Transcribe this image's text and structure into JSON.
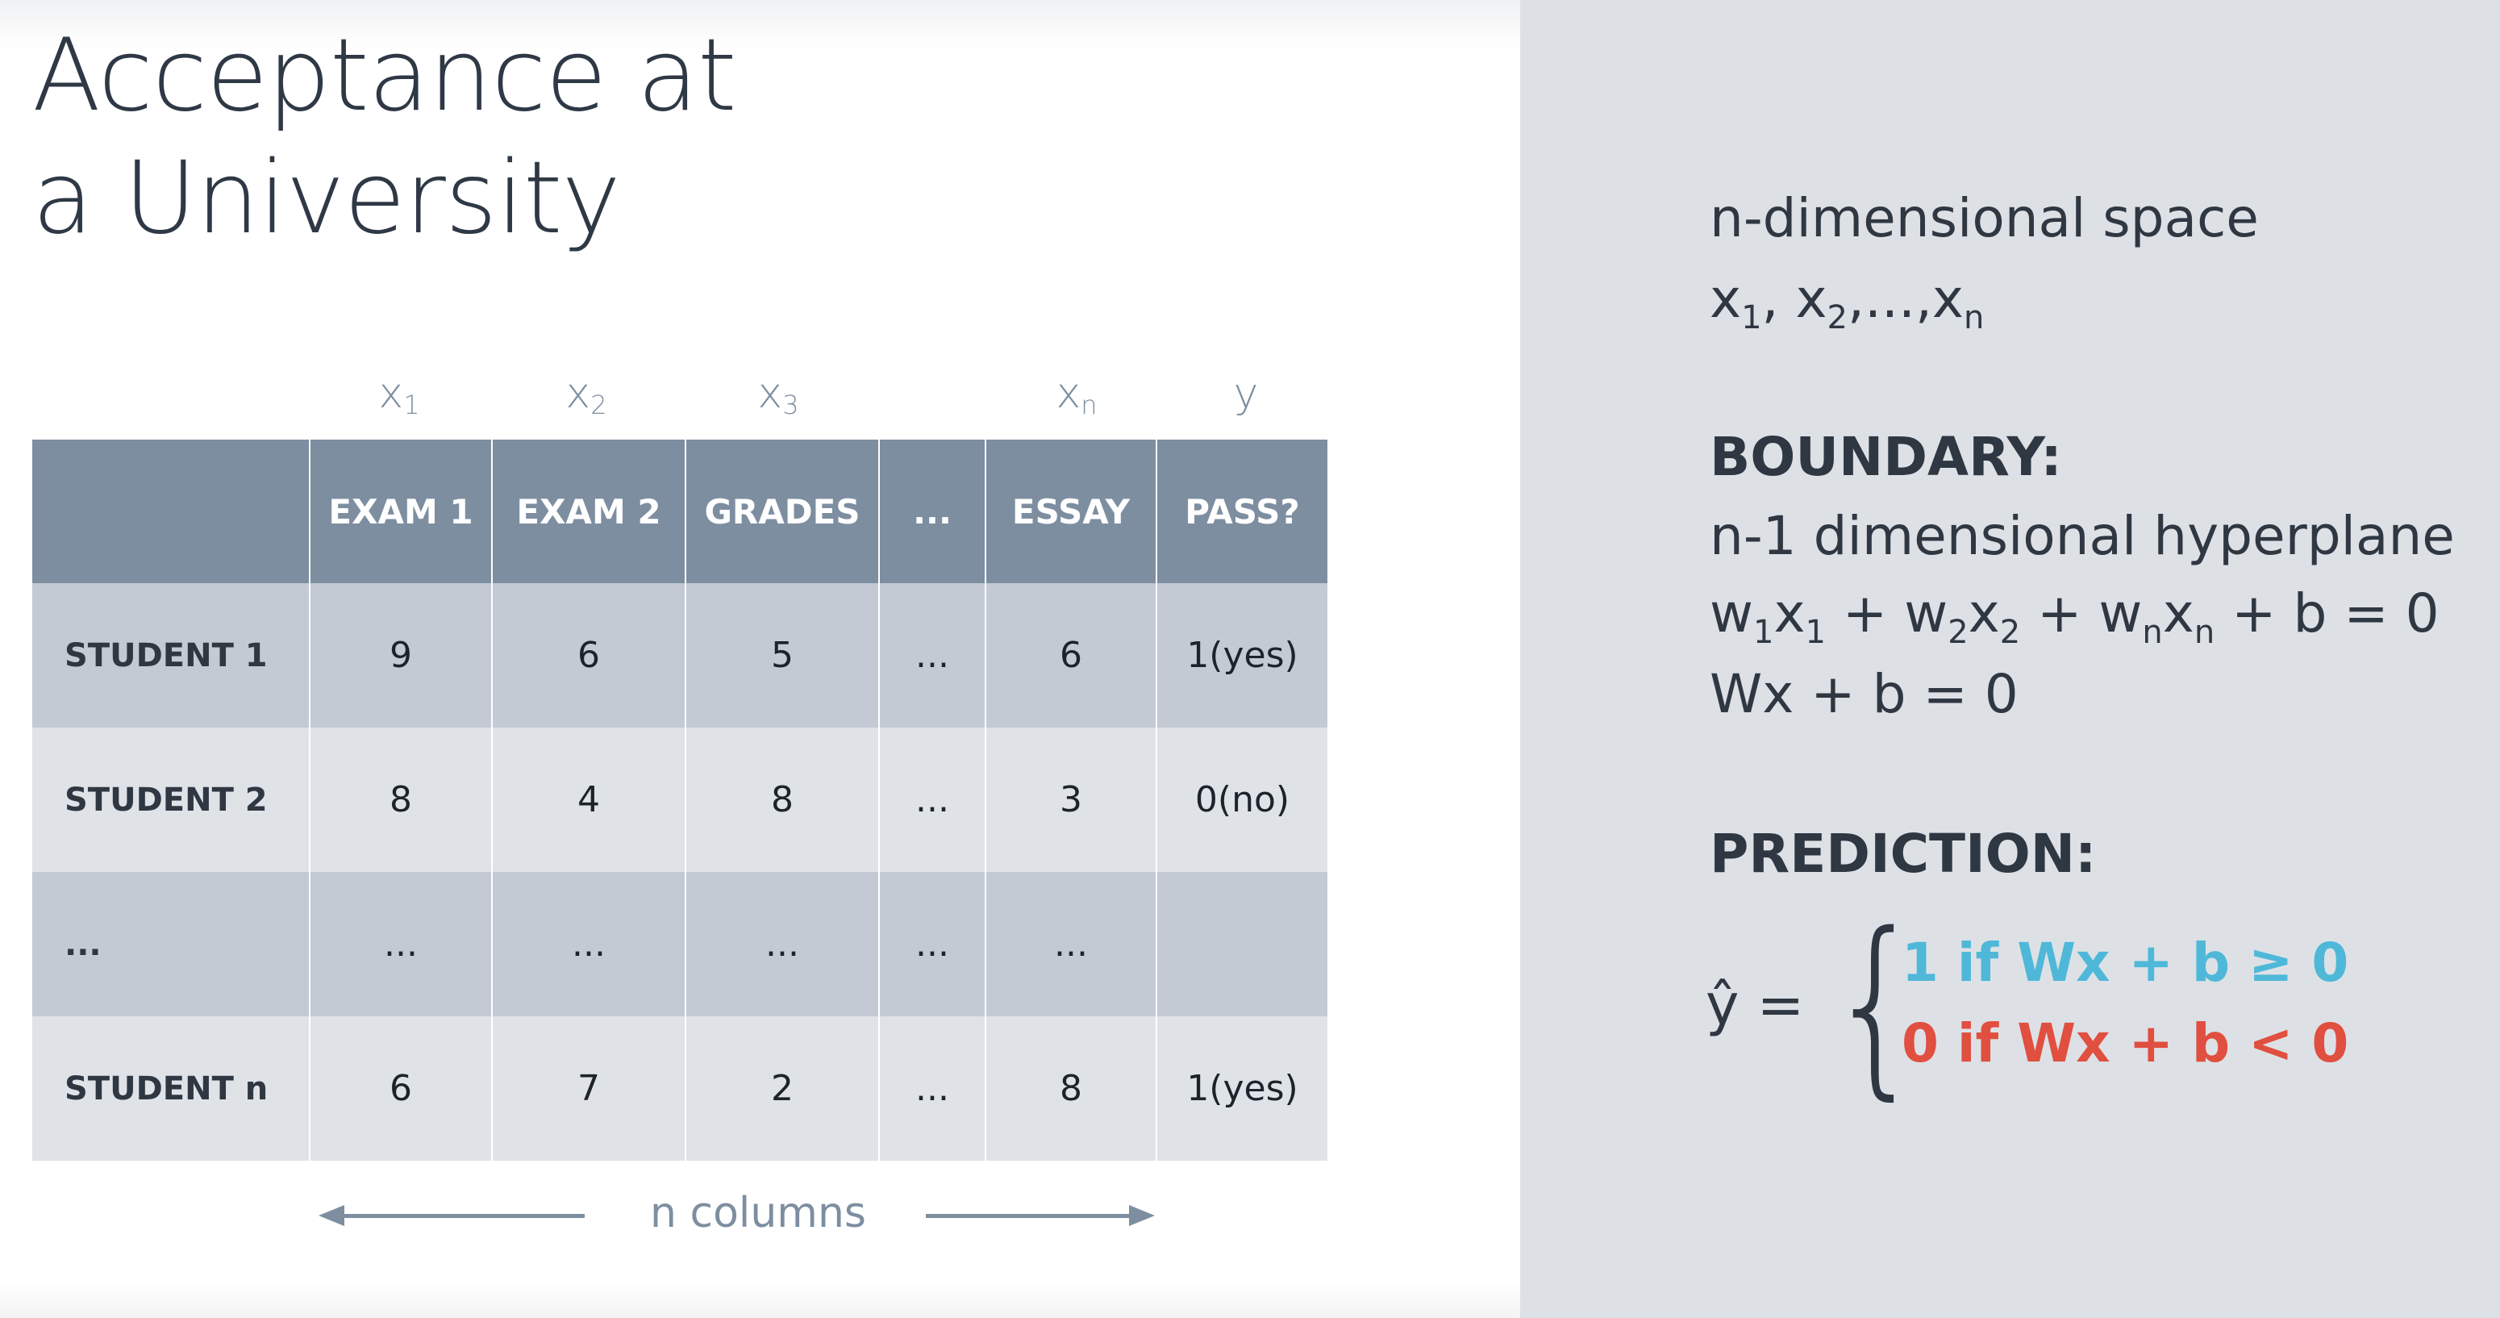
{
  "title": {
    "line1": "Acceptance at",
    "line2": "a University"
  },
  "variables": [
    {
      "base": "x",
      "sub": "1"
    },
    {
      "base": "x",
      "sub": "2"
    },
    {
      "base": "x",
      "sub": "3"
    },
    {
      "base": "x",
      "sub": "n"
    },
    {
      "base": "y",
      "sub": ""
    }
  ],
  "table": {
    "headers": [
      "",
      "EXAM 1",
      "EXAM 2",
      "GRADES",
      "...",
      "ESSAY",
      "PASS?"
    ],
    "rows": [
      [
        "STUDENT 1",
        "9",
        "6",
        "5",
        "...",
        "6",
        "1(yes)"
      ],
      [
        "STUDENT 2",
        "8",
        "4",
        "8",
        "...",
        "3",
        "0(no)"
      ],
      [
        "...",
        "...",
        "...",
        "...",
        "...",
        "...",
        ""
      ],
      [
        "STUDENT n",
        "6",
        "7",
        "2",
        "...",
        "8",
        "1(yes)"
      ]
    ]
  },
  "columns_label": "n columns",
  "right": {
    "space_heading": "n-dimensional space",
    "space_vars": {
      "x": "x",
      "sep": ",",
      "ellipsis": "...",
      "sub1": "1",
      "sub2": "2",
      "subn": "n"
    },
    "boundary_heading": "BOUNDARY:",
    "boundary_desc": "n-1 dimensional hyperplane",
    "boundary_eq2": "Wx + b = 0",
    "prediction_heading": "PREDICTION:",
    "yhat": "ŷ =",
    "brace": "{",
    "pred_positive": "1 if Wx + b ≥ 0",
    "pred_negative": "0 if Wx + b < 0"
  },
  "colors": {
    "header_bg": "#7e8ea1",
    "row_dark": "#c3cad3",
    "row_light": "#dfe3e8",
    "panel_bg": "#dde1e6",
    "positive": "#4fb8d8",
    "negative": "#e04f3f"
  }
}
